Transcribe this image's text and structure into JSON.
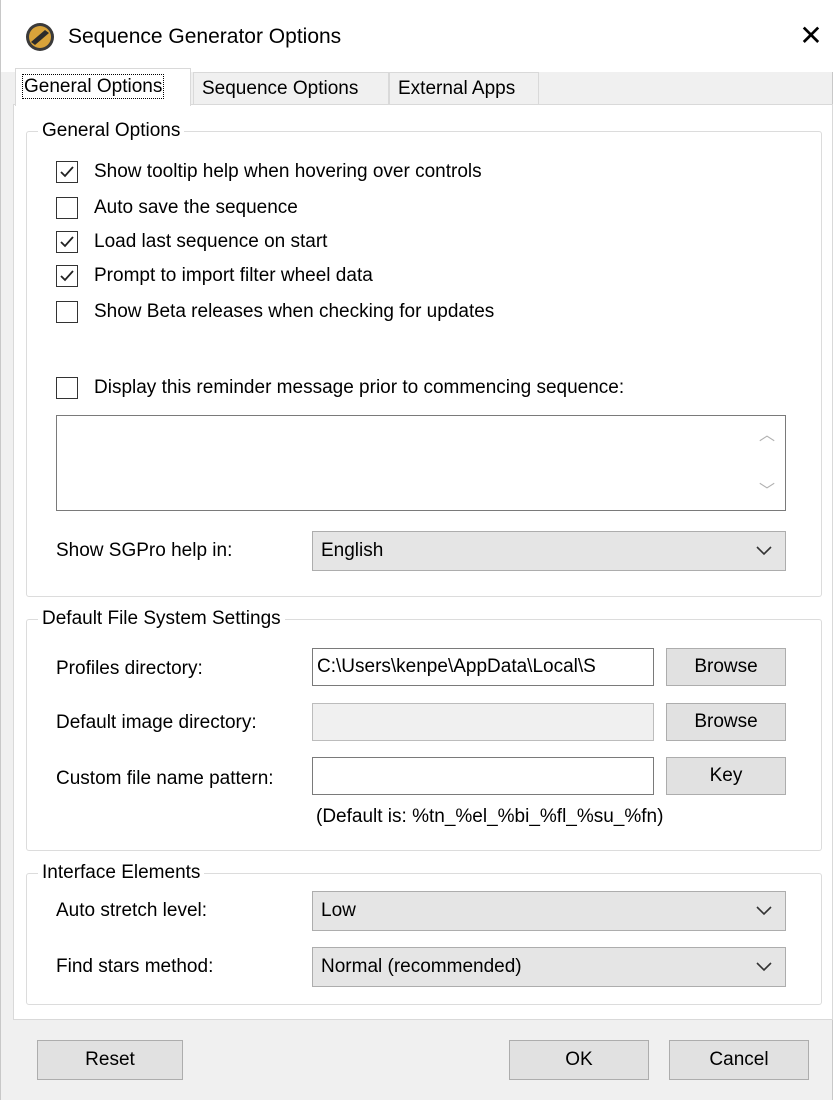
{
  "window": {
    "title": "Sequence Generator Options",
    "close_glyph": "✕"
  },
  "tabs": [
    {
      "label": "General Options",
      "active": true
    },
    {
      "label": "Sequence Options",
      "active": false
    },
    {
      "label": "External Apps",
      "active": false
    }
  ],
  "general": {
    "group_title": "General Options",
    "checkboxes": [
      {
        "label": "Show tooltip help when hovering over controls",
        "checked": true
      },
      {
        "label": "Auto save the sequence",
        "checked": false
      },
      {
        "label": "Load last sequence on start",
        "checked": true
      },
      {
        "label": "Prompt to import filter wheel data",
        "checked": true
      },
      {
        "label": "Show Beta releases when checking for updates",
        "checked": false
      }
    ],
    "reminder": {
      "label": "Display this reminder message prior to commencing sequence:",
      "checked": false,
      "text": ""
    },
    "help_lang": {
      "label": "Show SGPro help in:",
      "value": "English"
    }
  },
  "filesystem": {
    "group_title": "Default File System Settings",
    "profiles": {
      "label": "Profiles directory:",
      "value": "C:\\Users\\kenpe\\AppData\\Local\\S",
      "button": "Browse"
    },
    "image_dir": {
      "label": "Default image directory:",
      "value": "",
      "button": "Browse"
    },
    "pattern": {
      "label": "Custom file name pattern:",
      "value": "",
      "button": "Key"
    },
    "default_hint": "(Default is: %tn_%el_%bi_%fl_%su_%fn)"
  },
  "interface": {
    "group_title": "Interface Elements",
    "stretch": {
      "label": "Auto stretch level:",
      "value": "Low"
    },
    "stars": {
      "label": "Find stars method:",
      "value": "Normal (recommended)"
    }
  },
  "footer": {
    "reset": "Reset",
    "ok": "OK",
    "cancel": "Cancel"
  }
}
